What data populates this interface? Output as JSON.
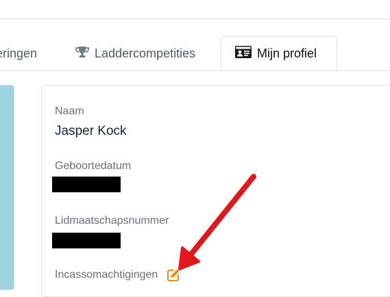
{
  "tabs": [
    {
      "label": "eringen",
      "active": false
    },
    {
      "label": "Laddercompetities",
      "icon": "trophy-icon",
      "active": false
    },
    {
      "label": "Mijn profiel",
      "icon": "id-card-icon",
      "active": true
    }
  ],
  "profile": {
    "name_label": "Naam",
    "name_value": "Jasper Kock",
    "birthdate_label": "Geboortedatum",
    "membership_label": "Lidmaatschapsnummer",
    "direct_debit_label": "Incassomachtigingen"
  },
  "colors": {
    "accent_orange": "#e8901a",
    "annotation_red": "#e0181e"
  }
}
